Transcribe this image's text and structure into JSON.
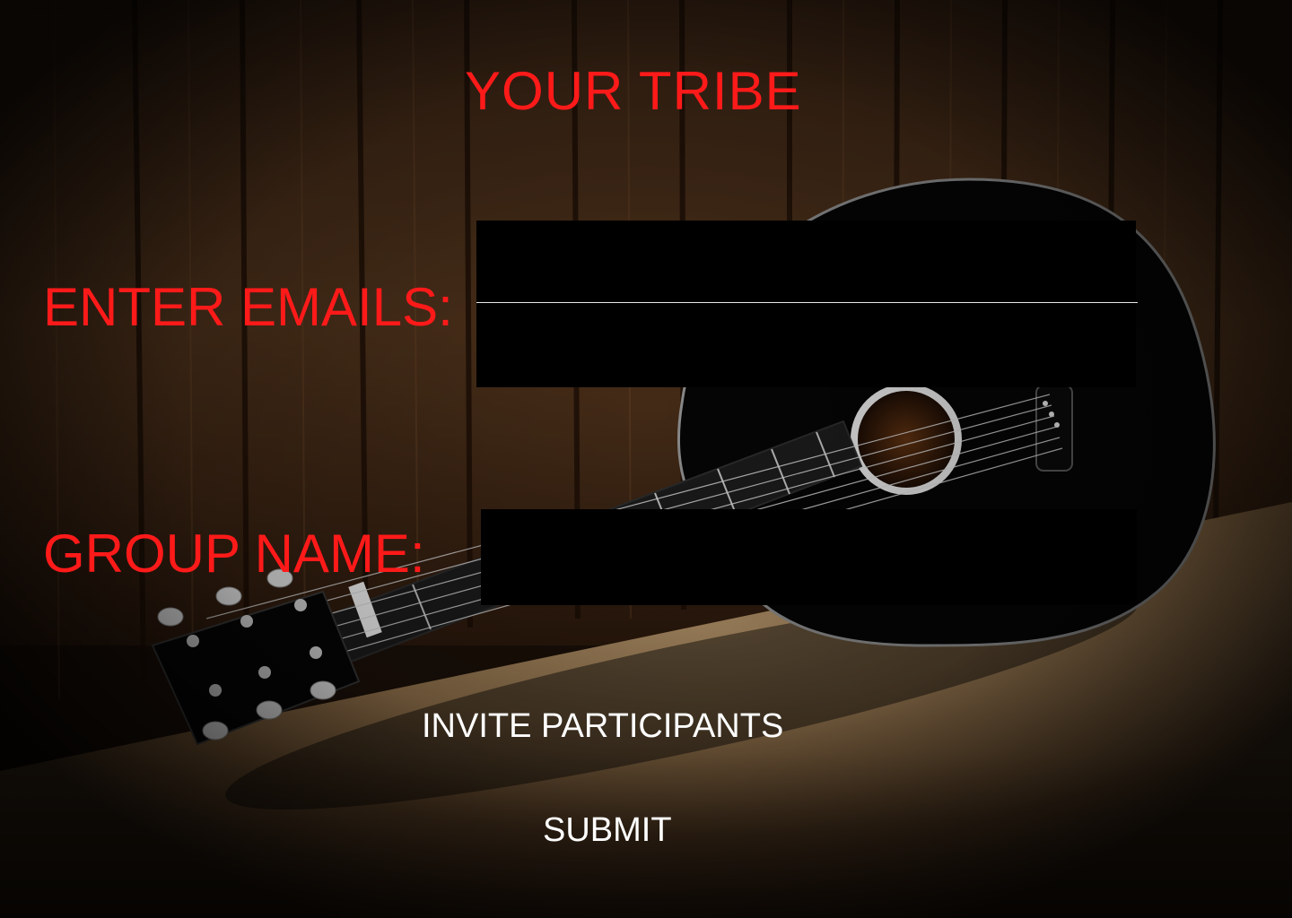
{
  "header": {
    "title": "YOUR TRIBE"
  },
  "form": {
    "emails_label": "ENTER EMAILS:",
    "emails_value": "",
    "group_label": "GROUP NAME:",
    "group_value": ""
  },
  "actions": {
    "invite_label": "INVITE PARTICIPANTS",
    "submit_label": "SUBMIT"
  },
  "theme": {
    "label_color": "#ff1a1a",
    "button_text_color": "#ffffff",
    "field_color": "#000000"
  },
  "background": {
    "subject": "acoustic-guitar-on-wooden-floor"
  }
}
